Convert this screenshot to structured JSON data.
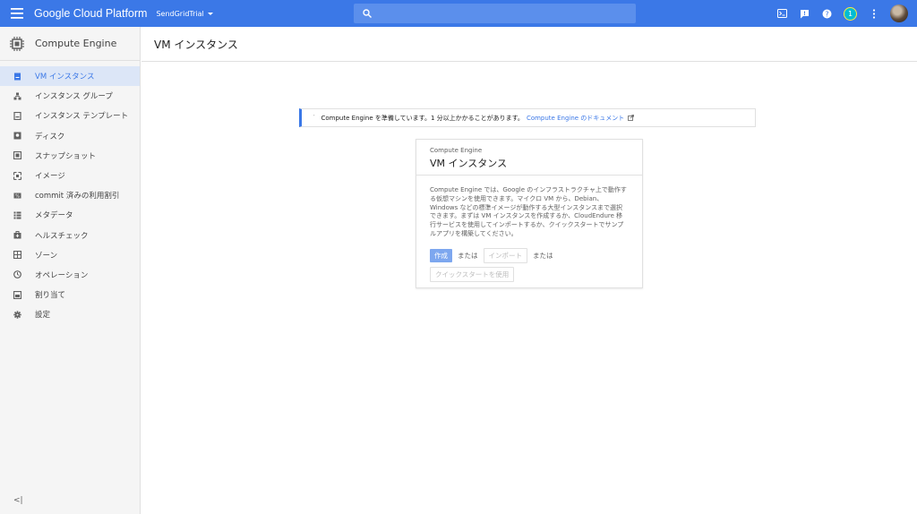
{
  "topbar": {
    "brand": "Google Cloud Platform",
    "project": "SendGridTrial",
    "search_placeholder": "",
    "notification_count": "1",
    "accent": "#3b78e7",
    "icons": [
      "cloud-shell-icon",
      "feedback-icon",
      "help-icon",
      "notifications-badge",
      "more-vert-icon",
      "avatar"
    ]
  },
  "sidebar": {
    "header": "Compute Engine",
    "items": [
      {
        "label": "VM インスタンス",
        "icon": "vm-instance-icon"
      },
      {
        "label": "インスタンス グループ",
        "icon": "instance-group-icon"
      },
      {
        "label": "インスタンス テンプレート",
        "icon": "instance-template-icon"
      },
      {
        "label": "ディスク",
        "icon": "disk-icon"
      },
      {
        "label": "スナップショット",
        "icon": "snapshot-icon"
      },
      {
        "label": "イメージ",
        "icon": "image-icon"
      },
      {
        "label": "commit 済みの利用割引",
        "icon": "commitment-icon"
      },
      {
        "label": "メタデータ",
        "icon": "metadata-icon"
      },
      {
        "label": "ヘルスチェック",
        "icon": "health-check-icon"
      },
      {
        "label": "ゾーン",
        "icon": "zone-icon"
      },
      {
        "label": "オペレーション",
        "icon": "operations-icon"
      },
      {
        "label": "割り当て",
        "icon": "quota-icon"
      },
      {
        "label": "設定",
        "icon": "settings-icon"
      }
    ],
    "collapse_label": "<|"
  },
  "main": {
    "title": "VM インスタンス",
    "notice": {
      "text": "Compute Engine を準備しています。1 分以上かかることがあります。",
      "link": "Compute Engine のドキュメント"
    },
    "card": {
      "subtitle": "Compute Engine",
      "title": "VM インスタンス",
      "description": "Compute Engine では、Google のインフラストラクチャ上で動作する仮想マシンを使用できます。マイクロ VM から、Debian、Windows などの標準イメージが動作する大型インスタンスまで選択できます。まずは VM インスタンスを作成するか、CloudEndure 移行サービスを使用してインポートするか、クイックスタートでサンプルアプリを構築してください。",
      "create_label": "作成",
      "or_label_1": "または",
      "import_label": "インポート",
      "or_label_2": "または",
      "quickstart_label": "クイックスタートを使用"
    }
  }
}
